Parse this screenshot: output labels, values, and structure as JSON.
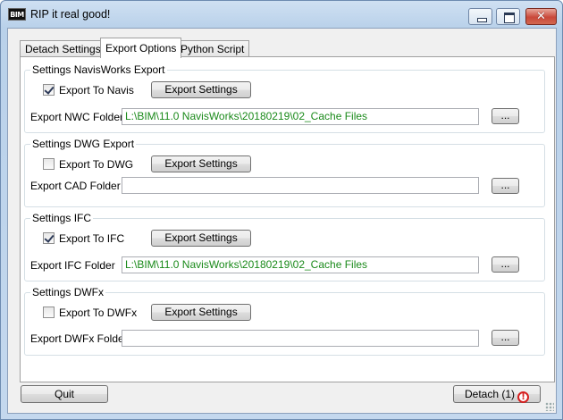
{
  "window": {
    "title": "RIP it real good!",
    "app_icon_text": "BIM",
    "close_glyph": "✕"
  },
  "tabs": [
    {
      "label": "Detach Settings",
      "active": false
    },
    {
      "label": "Export Options",
      "active": true
    },
    {
      "label": "Python Script",
      "active": false
    }
  ],
  "groups": {
    "navis": {
      "title": "Settings NavisWorks Export",
      "checkbox_label": "Export To Navis",
      "checked": true,
      "settings_button": "Export Settings",
      "folder_label": "Export NWC Folder",
      "folder_value": "L:\\BIM\\11.0 NavisWorks\\20180219\\02_Cache Files",
      "browse_button": "..."
    },
    "dwg": {
      "title": "Settings DWG Export",
      "checkbox_label": "Export To DWG",
      "checked": false,
      "settings_button": "Export Settings",
      "folder_label": "Export CAD Folder",
      "folder_value": "",
      "browse_button": "..."
    },
    "ifc": {
      "title": "Settings IFC",
      "checkbox_label": "Export To IFC",
      "checked": true,
      "settings_button": "Export Settings",
      "folder_label": "Export IFC Folder",
      "folder_value": "L:\\BIM\\11.0 NavisWorks\\20180219\\02_Cache Files",
      "browse_button": "..."
    },
    "dwfx": {
      "title": "Settings DWFx",
      "checkbox_label": "Export To DWFx",
      "checked": false,
      "settings_button": "Export Settings",
      "folder_label": "Export DWFx Folder",
      "folder_value": "",
      "browse_button": "..."
    }
  },
  "footer": {
    "quit_label": "Quit",
    "detach_label": "Detach (1)",
    "warning_glyph": "!"
  },
  "colors": {
    "path_text": "#1a8a1a",
    "warning": "#d62020",
    "close_button": "#c9483a"
  }
}
